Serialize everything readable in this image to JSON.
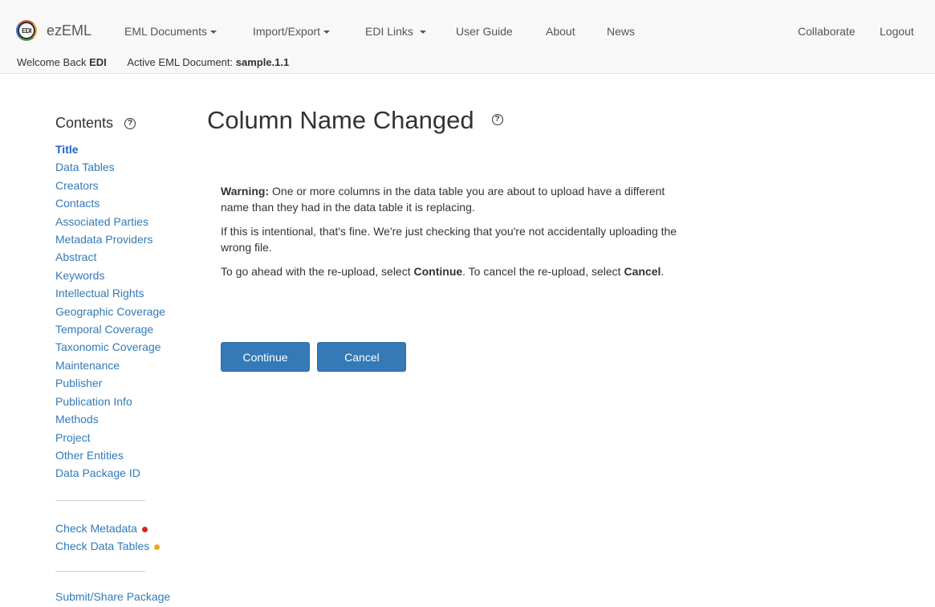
{
  "navbar": {
    "logo_text": "EDI",
    "brand": "ezEML",
    "menu": {
      "eml_documents": "EML Documents",
      "import_export": "Import/Export",
      "edi_links": "EDI Links",
      "user_guide": "User Guide",
      "about": "About",
      "news": "News",
      "collaborate": "Collaborate",
      "logout": "Logout"
    },
    "welcome_prefix": "Welcome Back",
    "user": "EDI",
    "active_doc_label": "Active EML Document:",
    "active_doc": "sample.1.1"
  },
  "sidebar": {
    "title": "Contents",
    "help_icon": "question-circle-icon",
    "items": [
      "Title",
      "Data Tables",
      "Creators",
      "Contacts",
      "Associated Parties",
      "Metadata Providers",
      "Abstract",
      "Keywords",
      "Intellectual Rights",
      "Geographic Coverage",
      "Temporal Coverage",
      "Taxonomic Coverage",
      "Maintenance",
      "Publisher",
      "Publication Info",
      "Methods",
      "Project",
      "Other Entities",
      "Data Package ID"
    ],
    "checks": {
      "metadata": "Check Metadata",
      "metadata_status_color": "#e02020",
      "data_tables": "Check Data Tables",
      "data_tables_status_color": "#f5a623"
    },
    "submit": "Submit/Share Package"
  },
  "main": {
    "title": "Column Name Changed",
    "warning_label": "Warning:",
    "warning_text": " One or more columns in the data table you are about to upload have a different name than they had in the data table it is replacing.",
    "intentional_text": "If this is intentional, that's fine. We're just checking that you're not accidentally uploading the wrong file.",
    "instruction_prefix": "To go ahead with the re-upload, select ",
    "instruction_continue": "Continue",
    "instruction_middle": ". To cancel the re-upload, select ",
    "instruction_cancel": "Cancel",
    "instruction_suffix": ".",
    "continue_button": "Continue",
    "cancel_button": "Cancel"
  },
  "colors": {
    "link": "#337ab7",
    "primary_button": "#337ab7"
  }
}
